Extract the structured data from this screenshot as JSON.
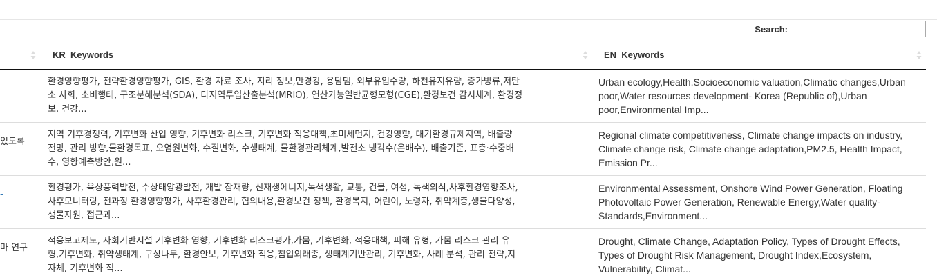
{
  "search": {
    "label": "Search:",
    "value": "",
    "placeholder": ""
  },
  "table": {
    "columns": [
      {
        "label": ""
      },
      {
        "label": "KR_Keywords"
      },
      {
        "label": "EN_Keywords"
      }
    ],
    "rows": [
      {
        "title": "",
        "kr": [
          "환경영향평가, 전략환경영향평가, GIS, 환경 자료 조사, 지리 정보,만경강, 용담댐, 외부유입수량, 하천유지유량, 증가방류,저탄",
          "소 사회, 소비행태, 구조분해분석(SDA), 다지역투입산출분석(MRIO), 연산가능일반균형모형(CGE),환경보건 감시체계, 환경정",
          "보, 건강..."
        ],
        "en": [
          "Urban ecology,Health,Socioeconomic valuation,Climatic changes,Urban",
          "poor,Water resources development- Korea (Republic of),Urban",
          "poor,Environmental Imp..."
        ]
      },
      {
        "title": "있도록",
        "kr": [
          "지역 기후경쟁력, 기후변화 산업 영향, 기후변화 리스크, 기후변화 적응대책,초미세먼지, 건강영향, 대기환경규제지역, 배출량",
          "전망, 관리 방향,물환경목표, 오염원변화, 수질변화, 수생태계, 물환경관리체계,발전소 냉각수(온배수), 배출기준, 표층·수중배",
          "수, 영향예측방안,원..."
        ],
        "en": [
          "Regional climate competitiveness, Climate change impacts on industry,",
          "Climate change risk, Climate change adaptation,PM2.5, Health Impact,",
          "Emission Pr..."
        ]
      },
      {
        "title": "-",
        "kr": [
          "환경평가, 육상풍력발전, 수상태양광발전, 개발 잠재량, 신재생에너지,녹색생활, 교통, 건물, 여성, 녹색의식,사후환경영향조사,",
          "사후모니터링, 전과정 환경영향평가, 사후환경관리, 협의내용,환경보건 정책, 환경복지, 어린이, 노령자, 취약계층,생물다양성,",
          "생물자원, 접근과..."
        ],
        "en": [
          "Environmental Assessment, Onshore Wind Power Generation, Floating",
          "Photovoltaic Power Generation, Renewable Energy,Water quality-",
          "Standards,Environment..."
        ]
      },
      {
        "title": "마 연구",
        "kr": [
          "적응보고제도, 사회기반시설 기후변화 영향, 기후변화 리스크평가,가뭄, 기후변화, 적응대책, 피해 유형, 가뭄 리스크 관리 유",
          "형,기후변화, 취약생태계, 구상나무, 환경안보, 기후변화 적응,침입외래종, 생태계기반관리, 기후변화, 사례 분석, 관리 전략,지",
          "자체, 기후변화 적..."
        ],
        "en": [
          "Drought, Climate Change, Adaptation Policy, Types of Drought Effects,",
          "Types of Drought Risk Management, Drought Index,Ecosystem,",
          "Vulnerability, Climat..."
        ]
      }
    ]
  }
}
